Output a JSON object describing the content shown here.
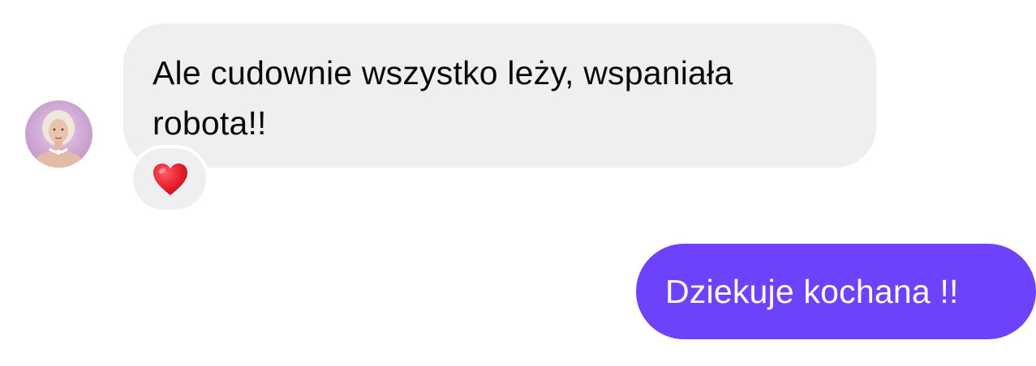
{
  "conversation": {
    "messages": [
      {
        "direction": "incoming",
        "text": "Ale cudownie wszystko leży, wspaniała robota!!",
        "reaction": "heart"
      },
      {
        "direction": "outgoing",
        "text": "Dziekuje kochana !!"
      }
    ]
  },
  "colors": {
    "incoming_bubble": "#efeff2",
    "outgoing_bubble": "#6e42fb",
    "reaction_heart": "#e8202f"
  }
}
